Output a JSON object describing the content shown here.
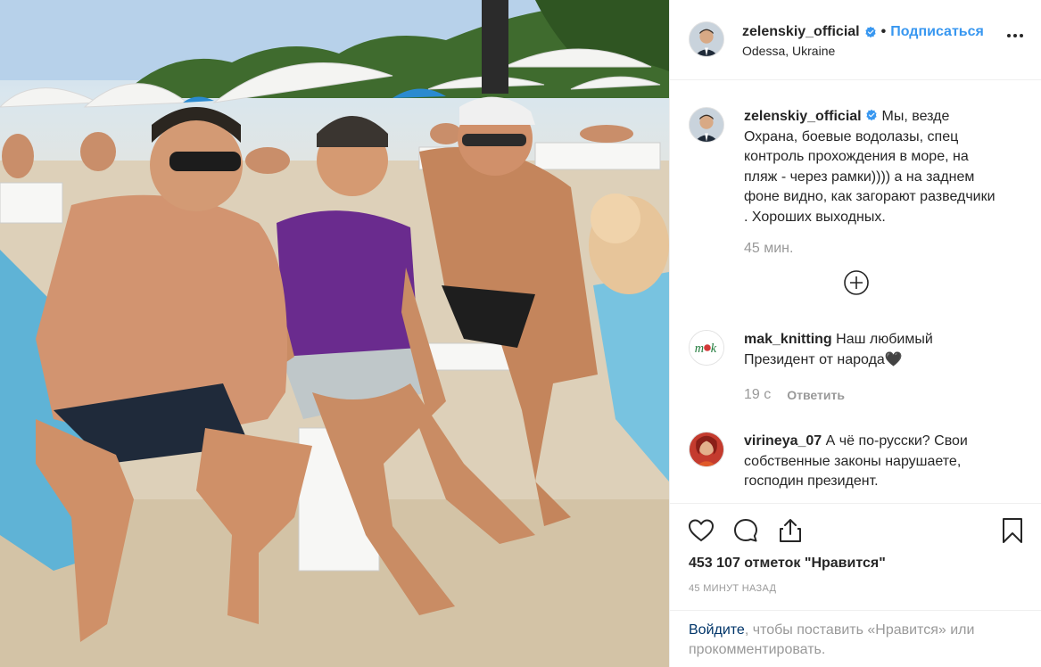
{
  "post": {
    "username": "zelenskiy_official",
    "separator": "•",
    "follow_label": "Подписаться",
    "location": "Odessa, Ukraine"
  },
  "caption": {
    "username": "zelenskiy_official",
    "text": "Мы, везде Охрана, боевые водолазы, спец контроль прохождения в море, на пляж - через рамки)))) а на заднем фоне видно, как загорают разведчики . Хороших выходных.",
    "time": "45 мин."
  },
  "comments": [
    {
      "username": "mak_knitting",
      "text": "Наш любимый Президент от народа🖤",
      "time": "19 с",
      "reply_label": "Ответить"
    },
    {
      "username": "virineya_07",
      "text": "А чё по-русски? Свои собственные законы нарушаете, господин президент."
    }
  ],
  "stats": {
    "likes": "453 107 отметок \"Нравится\"",
    "posted": "45 МИНУТ НАЗАД"
  },
  "login": {
    "link": "Войдите",
    "rest": ", чтобы поставить «Нравится» или прокомментировать."
  },
  "icons": {
    "more": "more-options-icon",
    "like": "heart-icon",
    "comment": "comment-icon",
    "share": "share-icon",
    "save": "bookmark-icon",
    "load_more": "plus-circle-icon",
    "verified": "verified-badge-icon"
  },
  "colors": {
    "link_blue": "#3897f0",
    "verified_blue": "#3897f0",
    "muted": "#999999",
    "text": "#262626"
  }
}
